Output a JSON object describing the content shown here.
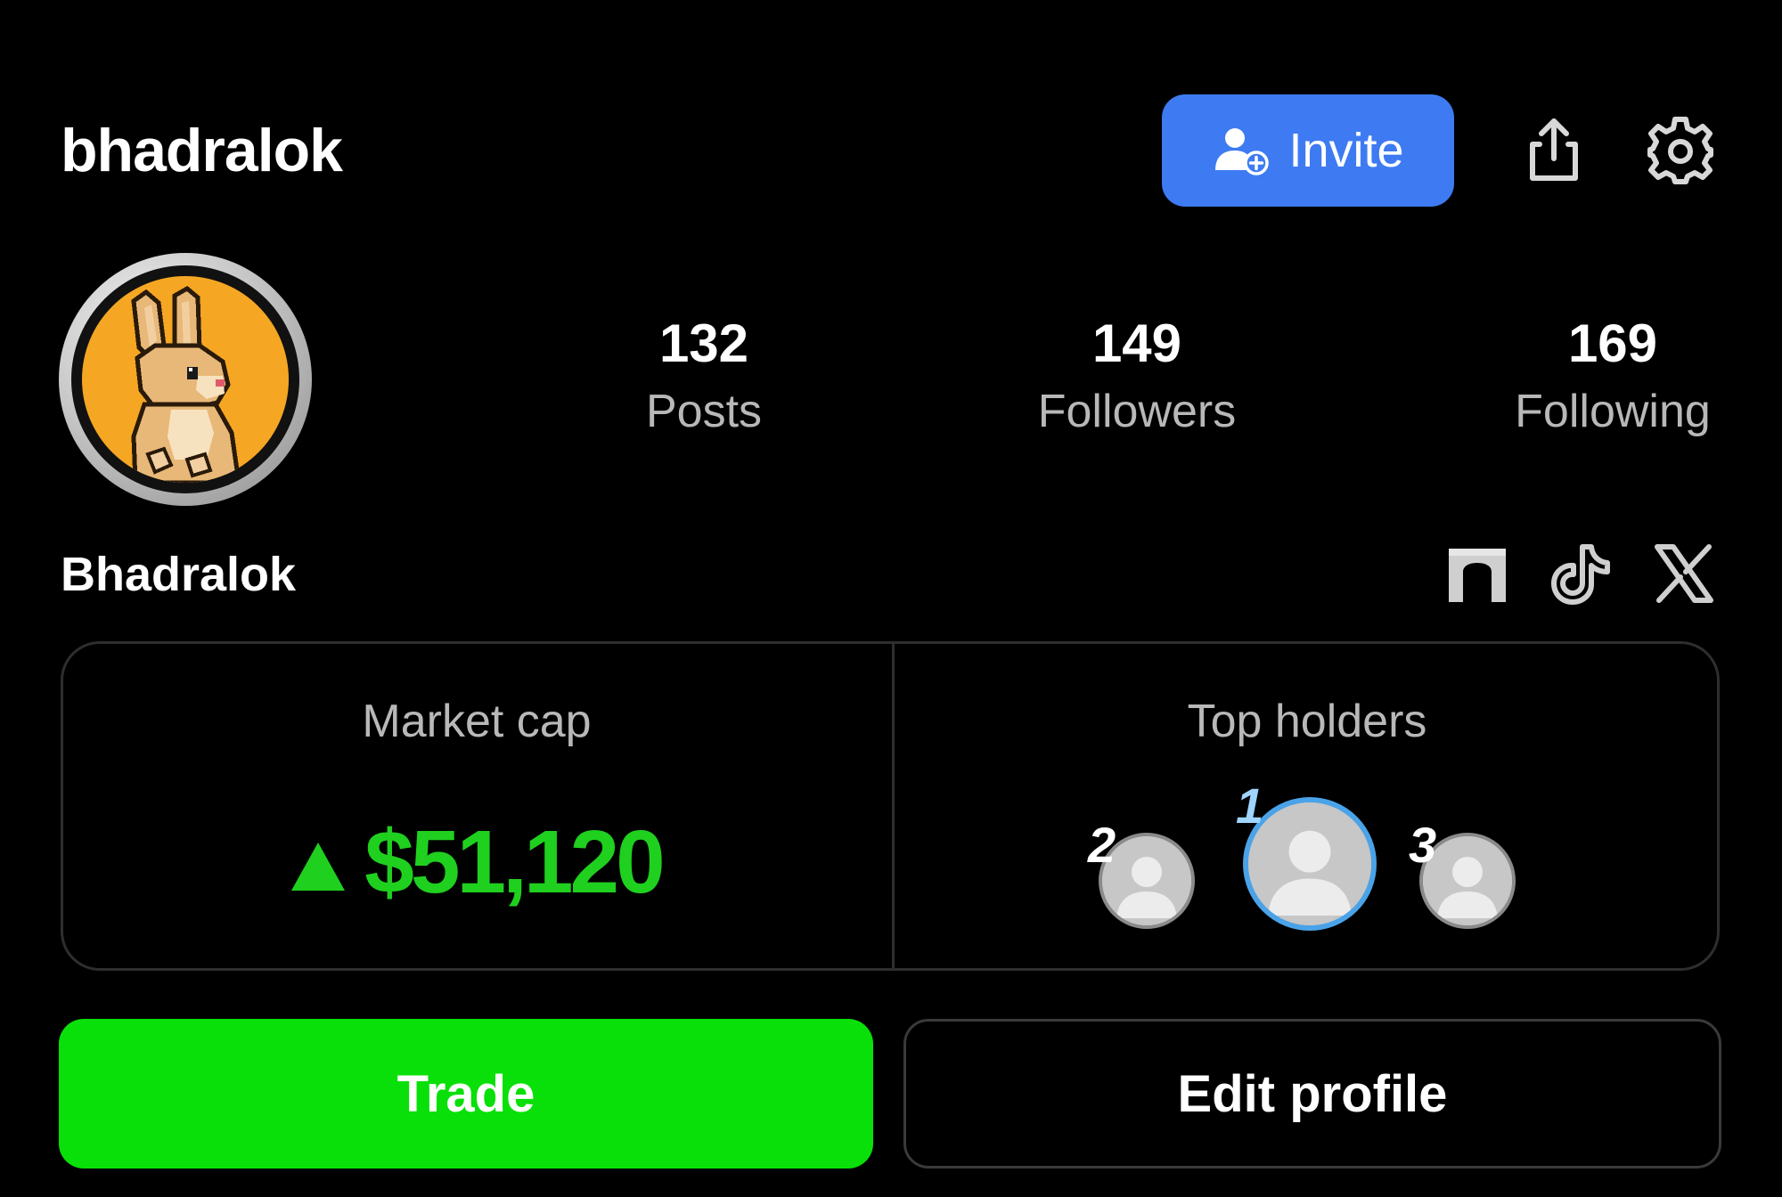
{
  "profile": {
    "username": "bhadralok",
    "display_name": "Bhadralok"
  },
  "header": {
    "invite_label": "Invite",
    "icons": [
      "invite-user-icon",
      "share-icon",
      "settings-gear-icon"
    ]
  },
  "stats": [
    {
      "value": "132",
      "label": "Posts"
    },
    {
      "value": "149",
      "label": "Followers"
    },
    {
      "value": "169",
      "label": "Following"
    }
  ],
  "social_links": [
    "arch-gate-icon",
    "tiktok-icon",
    "x-icon"
  ],
  "card": {
    "market_cap_title": "Market cap",
    "market_cap_value": "$51,120",
    "market_cap_trend": "up",
    "top_holders_title": "Top holders",
    "holders": [
      {
        "rank": "2"
      },
      {
        "rank": "1"
      },
      {
        "rank": "3"
      }
    ]
  },
  "actions": {
    "trade_label": "Trade",
    "edit_label": "Edit profile"
  },
  "colors": {
    "background": "#000000",
    "invite_blue": "#3e7bf2",
    "trade_green": "#09e009",
    "positive_green": "#1fd01f",
    "avatar_orange": "#f5a623",
    "holder_one_ring": "#4aa3e8"
  }
}
